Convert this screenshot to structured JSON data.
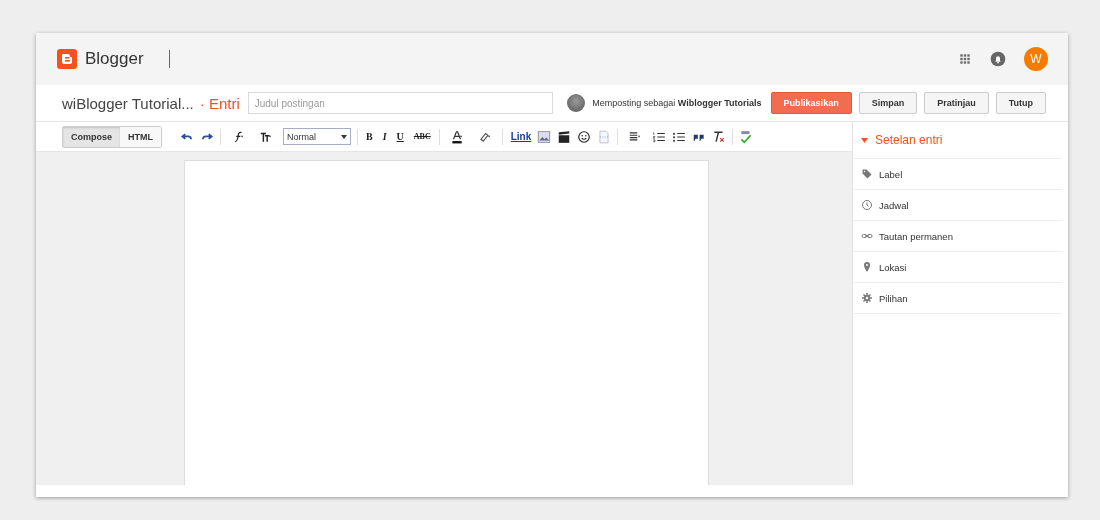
{
  "header": {
    "brand": "Blogger",
    "avatar_letter": "W"
  },
  "post_bar": {
    "blog_title": "wiBlogger Tutorial...",
    "section": "· Entri",
    "title_field": {
      "placeholder": "Judul postingan"
    },
    "posting_as": "Memposting sebagai **Wiblogger Tutorials**",
    "buttons": [
      {
        "label": "Publikasikan",
        "kind": "primary"
      },
      {
        "label": "Simpan",
        "kind": "plain"
      },
      {
        "label": "Pratinjau",
        "kind": "plain"
      },
      {
        "label": "Tutup",
        "kind": "plain"
      }
    ]
  },
  "toolbar": {
    "modes": [
      {
        "label": "Compose",
        "selected": true
      },
      {
        "label": "HTML",
        "selected": false
      }
    ],
    "font_size": "Normal",
    "format_letters": [
      "B",
      "I",
      "U",
      "ABC"
    ],
    "link": "Link"
  },
  "sidebar": {
    "title": "Setelan entri",
    "expanded": true,
    "items": [
      {
        "label": "Label",
        "kind": "tag"
      },
      {
        "label": "Jadwal",
        "kind": "clock"
      },
      {
        "label": "Tautan permanen",
        "kind": "link"
      },
      {
        "label": "Lokasi",
        "kind": "pin"
      },
      {
        "label": "Pilihan",
        "kind": "gear"
      }
    ]
  }
}
